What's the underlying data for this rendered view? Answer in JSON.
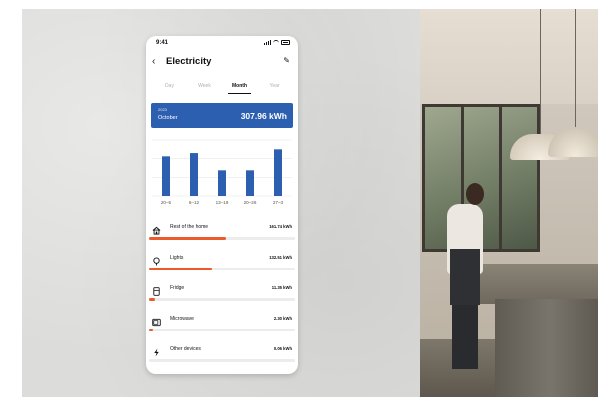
{
  "status_bar": {
    "time": "9:41"
  },
  "header": {
    "back_icon": "chevron-left-icon",
    "title": "Electricity",
    "edit_icon": "pencil-icon"
  },
  "tabs": [
    {
      "label": "Day",
      "active": false
    },
    {
      "label": "Week",
      "active": false
    },
    {
      "label": "Month",
      "active": true
    },
    {
      "label": "Year",
      "active": false
    }
  ],
  "summary": {
    "year": "2023",
    "month": "October",
    "total": "307.96 kWh",
    "color": "#2d5fb0"
  },
  "chart_data": {
    "type": "bar",
    "categories": [
      "20–5",
      "6–12",
      "13–19",
      "20–26",
      "27–3"
    ],
    "values": [
      85,
      92,
      55,
      55,
      100
    ],
    "bar_color": "#2d5fb0",
    "grid": true,
    "ylim": [
      0,
      120
    ]
  },
  "devices": [
    {
      "icon": "home-icon",
      "name": "Rest of the home",
      "value": "161.74 kWh",
      "share": 0.53
    },
    {
      "icon": "bulb-icon",
      "name": "Lights",
      "value": "132.51 kWh",
      "share": 0.43
    },
    {
      "icon": "fridge-icon",
      "name": "Fridge",
      "value": "11.35 kWh",
      "share": 0.04
    },
    {
      "icon": "microwave-icon",
      "name": "Microwave",
      "value": "2.30 kWh",
      "share": 0.01
    },
    {
      "icon": "bolt-icon",
      "name": "Other devices",
      "value": "0.06 kWh",
      "share": 0.0
    }
  ],
  "accent_color": "#ea5a2a"
}
